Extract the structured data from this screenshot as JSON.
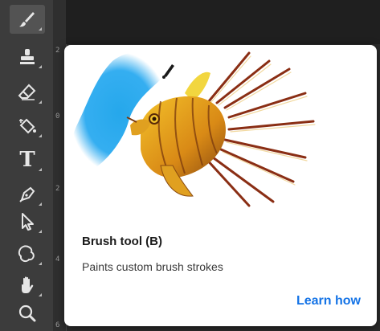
{
  "toolbar": {
    "tools": [
      {
        "name": "brush-tool-icon",
        "active": true
      },
      {
        "name": "clone-stamp-tool-icon",
        "active": false
      },
      {
        "name": "eraser-tool-icon",
        "active": false
      },
      {
        "name": "paint-bucket-tool-icon",
        "active": false
      },
      {
        "name": "type-tool-icon",
        "active": false
      },
      {
        "name": "pen-tool-icon",
        "active": false
      },
      {
        "name": "selection-tool-icon",
        "active": false
      },
      {
        "name": "custom-shape-tool-icon",
        "active": false
      },
      {
        "name": "hand-tool-icon",
        "active": false
      },
      {
        "name": "zoom-tool-icon",
        "active": false
      }
    ],
    "type_glyph": "T"
  },
  "ruler": {
    "ticks": [
      "2",
      "0",
      "2",
      "4",
      "6"
    ]
  },
  "tooltip": {
    "title": "Brush tool (B)",
    "description": "Paints custom brush strokes",
    "link": "Learn how"
  },
  "colors": {
    "accent": "#1473e6",
    "toolbar_bg": "#3c3c3c",
    "brush_stroke": "#1aa3ea"
  }
}
